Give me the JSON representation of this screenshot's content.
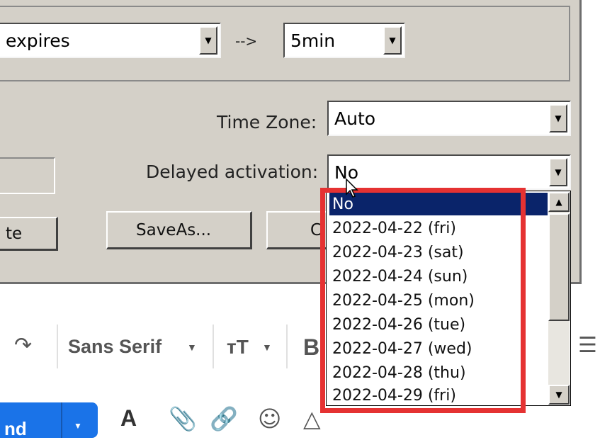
{
  "dialog": {
    "expire_select": {
      "value": "expires"
    },
    "arrow_label": "-->",
    "duration_select": {
      "value": "5min"
    },
    "time_zone": {
      "label": "Time Zone:",
      "value": "Auto"
    },
    "delayed_activation": {
      "label": "Delayed activation:",
      "value": "No"
    },
    "buttons": {
      "partial_left": "te",
      "save_as": "SaveAs...",
      "partial_right": "C"
    },
    "dropdown_options": [
      "No",
      "2022-04-22 (fri)",
      "2022-04-23 (sat)",
      "2022-04-24 (sun)",
      "2022-04-25 (mon)",
      "2022-04-26 (tue)",
      "2022-04-27 (wed)",
      "2022-04-28 (thu)",
      "2022-04-29 (fri)"
    ],
    "selected_option": "No"
  },
  "toolbar": {
    "font_family": "Sans Serif",
    "send_label": "nd"
  },
  "colors": {
    "dialog_bg": "#d4d0c8",
    "selection": "#0a246a",
    "highlight_border": "#e53232",
    "send_button": "#1a73e8"
  }
}
